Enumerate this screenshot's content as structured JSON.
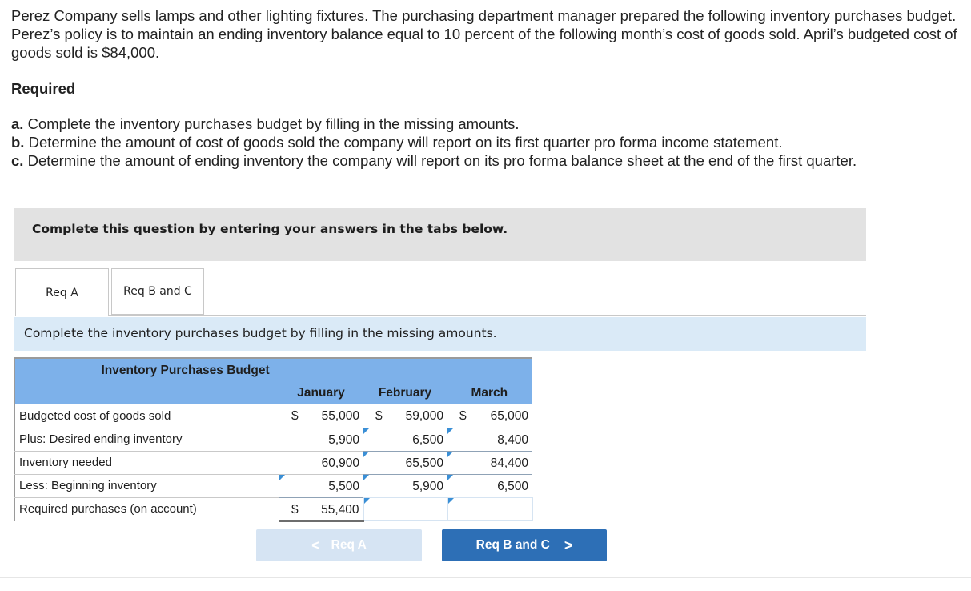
{
  "intro": "Perez Company sells lamps and other lighting fixtures. The purchasing department manager prepared the following inventory purchases budget. Perez’s policy is to maintain an ending inventory balance equal to 10 percent of the following month’s cost of goods sold. April’s budgeted cost of goods sold is $84,000.",
  "required_heading": "Required",
  "requirements": [
    {
      "letter": "a.",
      "text": "Complete the inventory purchases budget by filling in the missing amounts."
    },
    {
      "letter": "b.",
      "text": "Determine the amount of cost of goods sold the company will report on its first quarter pro forma income statement."
    },
    {
      "letter": "c.",
      "text": "Determine the amount of ending inventory the company will report on its pro forma balance sheet at the end of the first quarter."
    }
  ],
  "banner": "Complete this question by entering your answers in the tabs below.",
  "tabs": [
    "Req A",
    "Req B and C"
  ],
  "instruction": "Complete the inventory purchases budget by filling in the missing amounts.",
  "budget": {
    "title": "Inventory Purchases Budget",
    "months": [
      "January",
      "February",
      "March"
    ],
    "rows": [
      {
        "label": "Budgeted cost of goods sold",
        "jan_dollar": "$",
        "jan": "55,000",
        "feb_dollar": "$",
        "feb": "59,000",
        "mar_dollar": "$",
        "mar": "65,000"
      },
      {
        "label": "Plus: Desired ending inventory",
        "jan": "5,900",
        "feb": "6,500",
        "mar": "8,400"
      },
      {
        "label": "Inventory needed",
        "jan": "60,900",
        "feb": "65,500",
        "mar": "84,400"
      },
      {
        "label": "Less: Beginning inventory",
        "jan": "5,500",
        "feb": "5,900",
        "mar": "6,500"
      },
      {
        "label": "Required purchases (on account)",
        "jan_dollar": "$",
        "jan": "55,400",
        "feb": "",
        "mar": ""
      }
    ]
  },
  "nav": {
    "prev_label": "Req A",
    "next_label": "Req B and C"
  },
  "colors": {
    "header_blue": "#7db1ea",
    "instruction_bg": "#daeaf7",
    "banner_bg": "#e2e2e2",
    "next_button": "#2d6fb6",
    "prev_button": "#d6e4f3"
  }
}
